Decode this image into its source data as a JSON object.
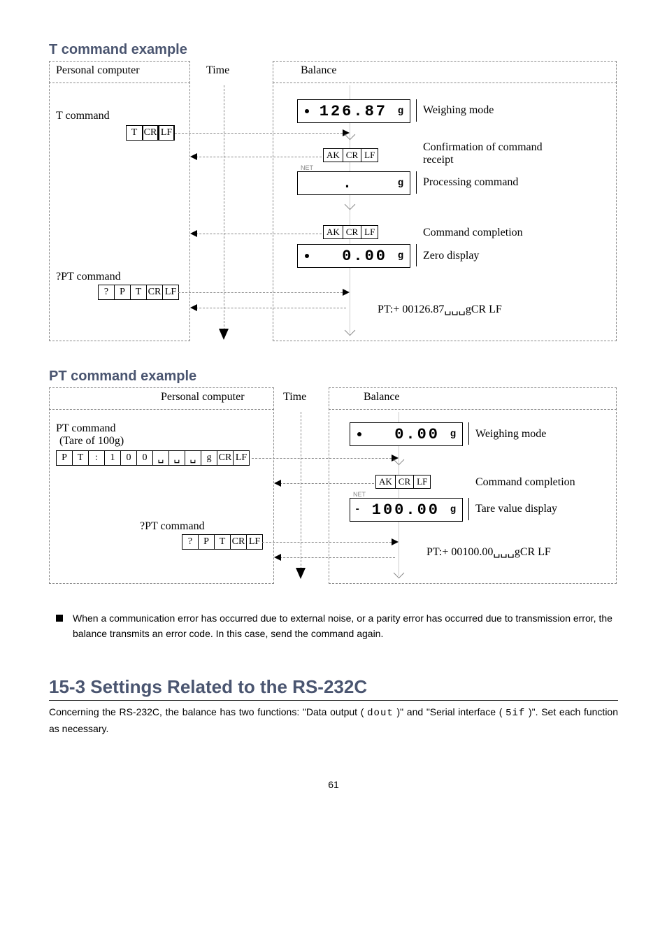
{
  "headings": {
    "t_example": "T command example",
    "pt_example": "PT command example",
    "section_15_3": "15-3 Settings Related to the RS-232C"
  },
  "diagram1": {
    "col_pc": "Personal computer",
    "col_time": "Time",
    "col_balance": "Balance",
    "t_command_label": "T command",
    "t_cells": [
      "T",
      "CR",
      "LF"
    ],
    "disp1_value": "126.87",
    "disp1_unit": "g",
    "label_weighing": "Weighing mode",
    "ak_cells": [
      "AK",
      "CR",
      "LF"
    ],
    "label_confirm": "Confirmation of command receipt",
    "net_tag": "NET",
    "disp2_value": ".",
    "disp2_unit": "g",
    "label_processing": "Processing command",
    "label_completion": "Command completion",
    "disp3_value": "0.00",
    "disp3_unit": "g",
    "label_zero": "Zero display",
    "pt_query_label": "?PT command",
    "pt_query_cells": [
      "?",
      "P",
      "T",
      "CR",
      "LF"
    ],
    "pt_response": "PT:+ 00126.87␣␣␣gCR LF"
  },
  "diagram2": {
    "col_pc": "Personal computer",
    "col_time": "Time",
    "col_balance": "Balance",
    "pt_command_label": "PT command",
    "pt_command_sub": "(Tare of 100g)",
    "pt_cells": [
      "P",
      "T",
      ":",
      "1",
      "0",
      "0",
      "␣",
      "␣",
      "␣",
      "g",
      "CR",
      "LF"
    ],
    "disp1_value": "0.00",
    "disp1_unit": "g",
    "label_weighing": "Weighing mode",
    "ak_cells": [
      "AK",
      "CR",
      "LF"
    ],
    "label_completion": "Command completion",
    "net_tag": "NET",
    "disp2_left": "-",
    "disp2_value": "100.00",
    "disp2_unit": "g",
    "label_tare": "Tare value display",
    "pt_query_label": "?PT command",
    "pt_query_cells": [
      "?",
      "P",
      "T",
      "CR",
      "LF"
    ],
    "pt_response": "PT:+ 00100.00␣␣␣gCR LF"
  },
  "error_para": "When a communication error has occurred due to external noise, or a parity error has occurred due to transmission error, the balance transmits an error code. In this case, send the command again.",
  "body_15_3_pre": "Concerning the RS-232C, the balance has two functions: \"Data output ( ",
  "body_15_3_dout": "dout",
  "body_15_3_mid": " )\" and \"Serial interface ( ",
  "body_15_3_sif": "5if",
  "body_15_3_post": " )\". Set each function as necessary.",
  "page_number": "61"
}
